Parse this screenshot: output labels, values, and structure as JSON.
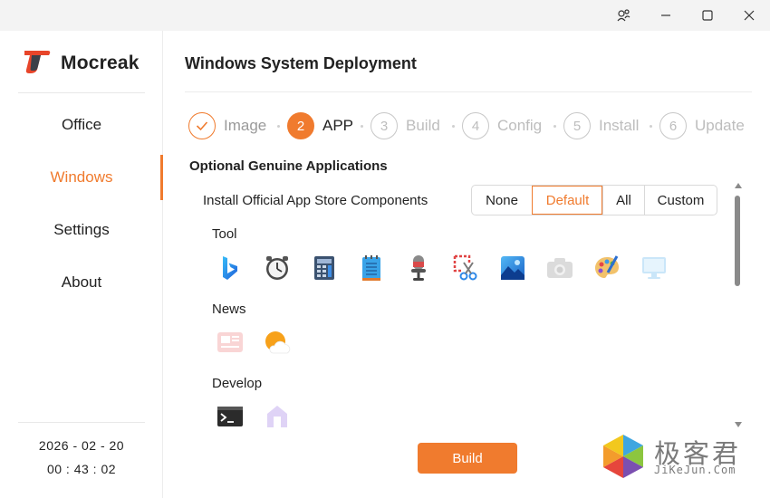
{
  "window": {
    "controls": [
      "settings-icon",
      "minimize-icon",
      "maximize-icon",
      "close-icon"
    ]
  },
  "sidebar": {
    "app_name": "Mocreak",
    "brand_color": "#f07b2e",
    "items": [
      {
        "label": "Office",
        "active": false
      },
      {
        "label": "Windows",
        "active": true
      },
      {
        "label": "Settings",
        "active": false
      },
      {
        "label": "About",
        "active": false
      }
    ],
    "date": "2026 - 02 - 20",
    "time": "00 : 43 : 02"
  },
  "main": {
    "title": "Windows System Deployment",
    "steps": [
      {
        "number": "✓",
        "label": "Image",
        "state": "done"
      },
      {
        "number": "2",
        "label": "APP",
        "state": "current"
      },
      {
        "number": "3",
        "label": "Build",
        "state": "pending"
      },
      {
        "number": "4",
        "label": "Config",
        "state": "pending"
      },
      {
        "number": "5",
        "label": "Install",
        "state": "pending"
      },
      {
        "number": "6",
        "label": "Update",
        "state": "pending"
      }
    ],
    "section_title": "Optional Genuine Applications",
    "store_label": "Install Official App Store Components",
    "preset_options": [
      "None",
      "Default",
      "All",
      "Custom"
    ],
    "preset_selected": "Default",
    "groups": [
      {
        "label": "Tool",
        "apps": [
          "bing-icon",
          "clock-icon",
          "calculator-icon",
          "notepad-icon",
          "voice-recorder-icon",
          "snipping-tool-icon",
          "photos-icon",
          "camera-icon",
          "paint-icon",
          "remote-desktop-icon"
        ]
      },
      {
        "label": "News",
        "apps": [
          "news-icon",
          "weather-icon"
        ]
      },
      {
        "label": "Develop",
        "apps": [
          "terminal-icon",
          "dev-home-icon"
        ]
      }
    ],
    "build_label": "Build"
  },
  "watermark": {
    "text": "极客君",
    "sub": "JiKeJun.Com"
  }
}
